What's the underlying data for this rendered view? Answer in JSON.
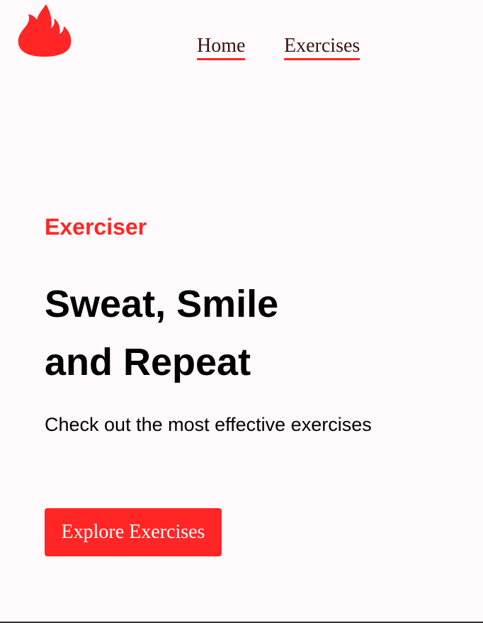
{
  "header": {
    "logo_icon": "flame-icon",
    "nav": [
      {
        "label": "Home"
      },
      {
        "label": "Exercises"
      }
    ]
  },
  "hero": {
    "brand": "Exerciser",
    "headline_line1": "Sweat, Smile",
    "headline_line2": "and Repeat",
    "subtext": "Check out the most effective exercises",
    "cta_label": "Explore Exercises"
  },
  "colors": {
    "accent": "#ff2625",
    "background": "#fffafb",
    "text": "#000000",
    "nav_text": "#3a1212"
  }
}
